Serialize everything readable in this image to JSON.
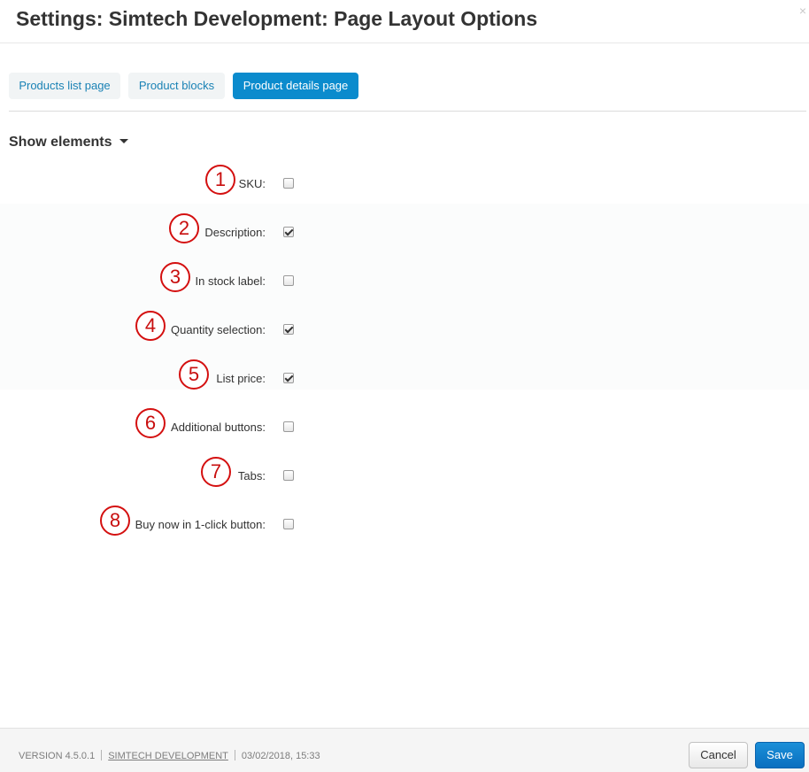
{
  "dialog": {
    "title": "Settings: Simtech Development: Page Layout Options",
    "close_glyph": "×"
  },
  "tabs": [
    {
      "label": "Products list page",
      "active": false
    },
    {
      "label": "Product blocks",
      "active": false
    },
    {
      "label": "Product details page",
      "active": true
    }
  ],
  "section": {
    "title": "Show elements",
    "caret_icon": "caret-down-icon"
  },
  "fields": [
    {
      "number": "1",
      "label": "SKU:",
      "checked": false
    },
    {
      "number": "2",
      "label": "Description:",
      "checked": true
    },
    {
      "number": "3",
      "label": "In stock label:",
      "checked": false
    },
    {
      "number": "4",
      "label": "Quantity selection:",
      "checked": true
    },
    {
      "number": "5",
      "label": "List price:",
      "checked": true
    },
    {
      "number": "6",
      "label": "Additional buttons:",
      "checked": false
    },
    {
      "number": "7",
      "label": "Tabs:",
      "checked": false
    },
    {
      "number": "8",
      "label": "Buy now in 1-click button:",
      "checked": false
    }
  ],
  "footer": {
    "version": "VERSION 4.5.0.1",
    "developer": "SIMTECH DEVELOPMENT",
    "datetime": "03/02/2018, 15:33",
    "cancel_label": "Cancel",
    "save_label": "Save"
  },
  "colors": {
    "accent": "#0b8bcd",
    "tab_link": "#1a82b5",
    "annotation": "#d41010"
  }
}
